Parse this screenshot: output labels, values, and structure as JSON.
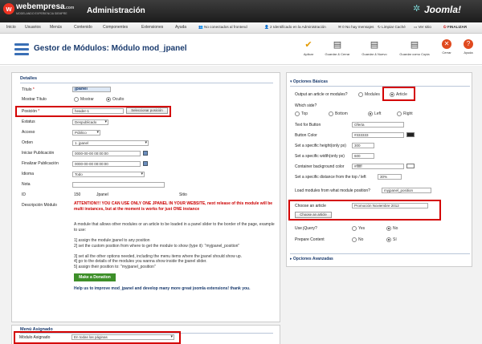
{
  "topbar": {
    "logo_text": "webempresa",
    "logo_suffix": ".com",
    "logo_tagline": "MODELANDO EXPERIENCIA SIEMPRE",
    "admin_title": "Administración",
    "brand": "Joomla!"
  },
  "menu": {
    "items": [
      "Inicio",
      "Usuarios",
      "Menús",
      "Contenido",
      "Componentes",
      "Extensiones",
      "Ayuda"
    ],
    "status": [
      "No conectados al frontend",
      "2 Identificado en la Administración",
      "0 No hay mensajes",
      "Limpiar Caché",
      "Ver sitio",
      "FINALIZAR"
    ]
  },
  "toolbar": {
    "title": "Gestor de Módulos: Módulo mod_jpanel",
    "buttons": [
      "Aplicar",
      "Guardar & Cerrar",
      "Guardar & Nuevo",
      "Guardar como Copia",
      "Cerrar",
      "Ayuda"
    ]
  },
  "details": {
    "section_title": "Detalles",
    "title_label": "Título",
    "title_value": "jpanel",
    "show_title_label": "Mostrar Título",
    "show_option": "Mostrar",
    "hide_option": "Oculto",
    "position_label": "Posición",
    "position_value": "header-1",
    "position_button": "Seleccionar posición",
    "status_label": "Estatus",
    "status_value": "Despublicado",
    "access_label": "Acceso",
    "access_value": "Público",
    "order_label": "Orden",
    "order_value": "1. jpanel",
    "start_label": "Iniciar Publicación",
    "start_value": "0000-00-00 00:00:00",
    "finish_label": "Finalizar Publicación",
    "finish_value": "0000-00-00 00:00:00",
    "language_label": "Idioma",
    "language_value": "Todo",
    "note_label": "Nota",
    "id_label": "ID",
    "id_value": "150",
    "module_name": "Jpanel",
    "site_label": "Sitio",
    "description_label": "Descripción Módulo",
    "warning_text": "ATTENTION!!! YOU CAN USE ONLY ONE JPANEL IN YOUR WEBSITE, next release of this module will be multi instances, but at the moment is works for just ONE instance",
    "desc_intro": "A module that allows other modules or an article to be loaded in a panel slider to the border of the page, example to use:",
    "desc_steps": [
      "1] assign the module jpanel to any position",
      "2] set the custom position from where to get the module to show (type it): \"myjpanel_position\"",
      "3] set all the other options needed, including the menu items where the jpanel should show up.",
      "4] go to the details of the modules you wanna show inside the jpanel slider.",
      "5] assign their position to: \"myjpanel_position\""
    ],
    "donate_button": "Make a Donation",
    "desc_outro": "Help us to improve mod_jpanel and develop many more great joomla extensions! thank you."
  },
  "menu_assign": {
    "section_title": "Menú Asignado",
    "label": "Módulo Asignado",
    "value": "En todas las páginas"
  },
  "options": {
    "basic_header": "Opciones Básicas",
    "advanced_header": "Opciones Avanzadas",
    "output_label": "Output an article or modules?",
    "output_modules": "Modules",
    "output_article": "Article",
    "which_side_label": "Which side?",
    "side_top": "Top",
    "side_bottom": "Bottom",
    "side_left": "Left",
    "side_right": "Right",
    "button_text_label": "Text for Button",
    "button_text_value": "Oferta",
    "button_color_label": "Button Color",
    "button_color_value": "#333333",
    "button_color_hex": "#222222",
    "height_label": "Set a specific height(only px)",
    "height_value": "300",
    "width_label": "Set a specific width(only px)",
    "width_value": "600",
    "bg_label": "Container background color",
    "bg_value": "#ffffff",
    "bg_hex": "#ffffff",
    "distance_label": "Set a specific distance from the top / left",
    "distance_value": "30%",
    "load_label": "Load modules from what module position?",
    "load_value": "myjpanel_position",
    "choose_label": "Choose an article",
    "choose_value": "Promoción Noviembre 2012",
    "choose_button": "Choose an article",
    "jquery_label": "Use jQuery?",
    "jquery_yes": "Yes",
    "jquery_no": "No",
    "prepare_label": "Prepare Content",
    "prepare_no": "No",
    "prepare_yes": "Sí"
  },
  "colors": {
    "accent": "#1a3b6e",
    "highlight": "#d40000",
    "donate": "#3d8f29"
  }
}
